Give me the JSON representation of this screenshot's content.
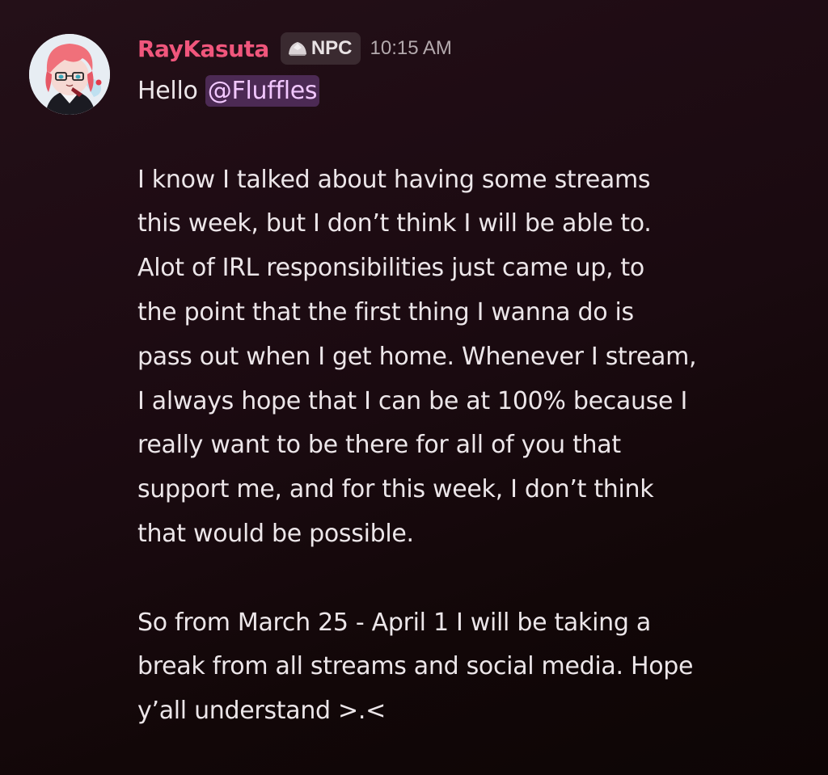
{
  "message": {
    "author": {
      "name": "RayKasuta",
      "name_color": "#f0567c"
    },
    "tag": {
      "icon": "npc-badge-icon",
      "label": "NPC"
    },
    "timestamp": "10:15 AM",
    "greeting": "Hello",
    "mention": "@Fluffles",
    "mention_color": "#f2c8ff",
    "paragraph1": [
      "I know I talked about having some streams",
      "this week, but I don’t think I will be able to.",
      "Alot of IRL responsibilities just came up, to",
      "the point that the first thing I wanna do is",
      "pass out when I get home. Whenever I stream,",
      "I always hope that I can be at 100% because I",
      "really want to be there for all of you that",
      "support me, and for this week, I don’t think",
      "that would be possible."
    ],
    "paragraph2": [
      "So from March 25 - April 1 I will be taking a",
      "break from all streams and social media. Hope",
      "y’all understand >.<"
    ]
  }
}
